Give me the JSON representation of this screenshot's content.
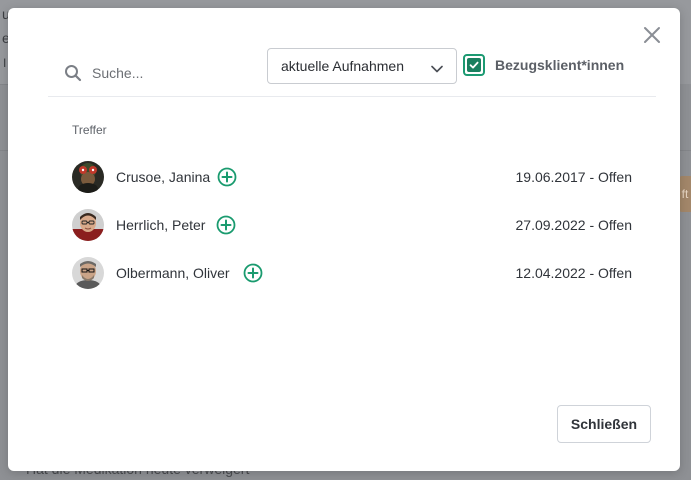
{
  "background": {
    "visible_fragments": [
      "u",
      "e",
      "I",
      "ft"
    ],
    "footer_text": "Hat die Medikation heute verweigert"
  },
  "modal": {
    "close_icon": "close-icon",
    "search": {
      "placeholder": "Suche...",
      "value": "",
      "icon": "search-icon"
    },
    "filter_select": {
      "selected": "aktuelle Aufnahmen",
      "icon": "chevron-down-icon"
    },
    "checkbox": {
      "label": "Bezugsklient*innen",
      "checked": true
    },
    "section_title": "Treffer",
    "results": [
      {
        "name": "Crusoe, Janina",
        "status": "19.06.2017 - Offen"
      },
      {
        "name": "Herrlich, Peter",
        "status": "27.09.2022 - Offen"
      },
      {
        "name": "Olbermann, Oliver",
        "status": "12.04.2022 - Offen"
      }
    ],
    "footer_button": "Schließen"
  },
  "colors": {
    "accent": "#1a9b6f",
    "accent_dark": "#1a7f5f",
    "overlay": "#8e9094",
    "text": "#30343a"
  }
}
